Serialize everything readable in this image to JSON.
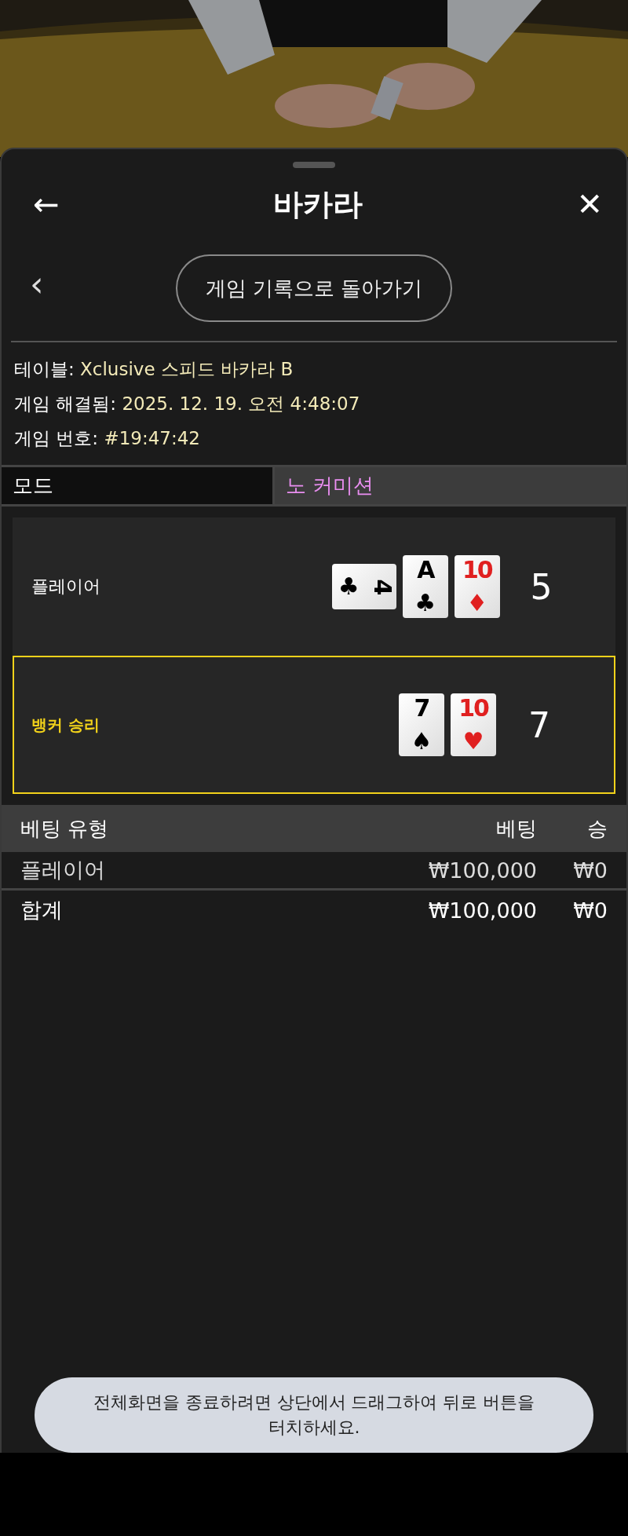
{
  "header": {
    "back_icon": "←",
    "title": "바카라",
    "close_icon": "✕"
  },
  "history_nav": {
    "chevron": "‹",
    "button": "게임 기록으로 돌아가기"
  },
  "info": [
    {
      "label": "테이블:",
      "value": "Xclusive 스피드 바카라 B"
    },
    {
      "label": "게임 해결됨:",
      "value": "2025. 12. 19. 오전 4:48:07"
    },
    {
      "label": "게임 번호:",
      "value": "#19:47:42"
    }
  ],
  "mode": {
    "label": "모드",
    "value": "노 커미션"
  },
  "hands": [
    {
      "label": "플레이어",
      "winner": false,
      "score": "5",
      "cards": [
        {
          "rank": "4",
          "suit": "♣",
          "color": "#000000",
          "rotated": true
        },
        {
          "rank": "A",
          "suit": "♣",
          "color": "#000000",
          "rotated": false
        },
        {
          "rank": "10",
          "suit": "♦",
          "color": "#e02020",
          "rotated": false
        }
      ]
    },
    {
      "label": "뱅커 승리",
      "winner": true,
      "score": "7",
      "cards": [
        {
          "rank": "7",
          "suit": "♠",
          "color": "#000000",
          "rotated": false
        },
        {
          "rank": "10",
          "suit": "♥",
          "color": "#e02020",
          "rotated": false
        }
      ]
    }
  ],
  "bets_table": {
    "columns": [
      "베팅 유형",
      "베팅",
      "승"
    ],
    "rows": [
      {
        "type": "플레이어",
        "bet": "₩100,000",
        "win": "₩0"
      }
    ],
    "total": {
      "type": "합계",
      "bet": "₩100,000",
      "win": "₩0"
    }
  },
  "toast": "전체화면을 종료하려면 상단에서 드래그하여 뒤로 버튼을 터치하세요."
}
